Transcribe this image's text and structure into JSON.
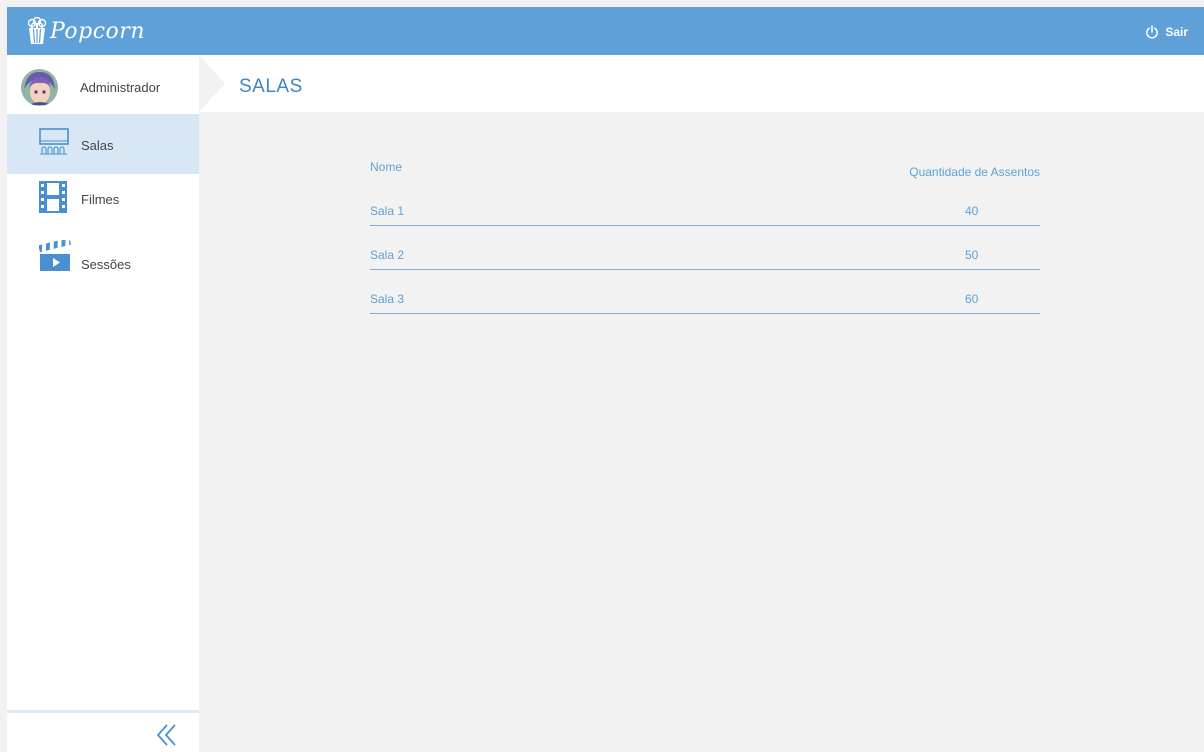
{
  "app": {
    "name": "Popcorn"
  },
  "header": {
    "logout_label": "Sair"
  },
  "user": {
    "name": "Administrador"
  },
  "sidebar": {
    "items": [
      {
        "label": "Salas",
        "icon": "cinema-seats-icon",
        "active": true
      },
      {
        "label": "Filmes",
        "icon": "film-strip-icon",
        "active": false
      },
      {
        "label": "Sessões",
        "icon": "clapperboard-icon",
        "active": false
      }
    ],
    "collapse_icon": "double-chevron-left-icon"
  },
  "page": {
    "title": "SALAS"
  },
  "table": {
    "columns": [
      "Nome",
      "Quantidade de Assentos"
    ],
    "rows": [
      {
        "name": "Sala 1",
        "seats": "40"
      },
      {
        "name": "Sala 2",
        "seats": "50"
      },
      {
        "name": "Sala 3",
        "seats": "60"
      }
    ]
  },
  "colors": {
    "accent": "#5fa0d8",
    "title": "#3d86c6",
    "active_item": "#d8e7f5",
    "background": "#f2f2f2"
  }
}
